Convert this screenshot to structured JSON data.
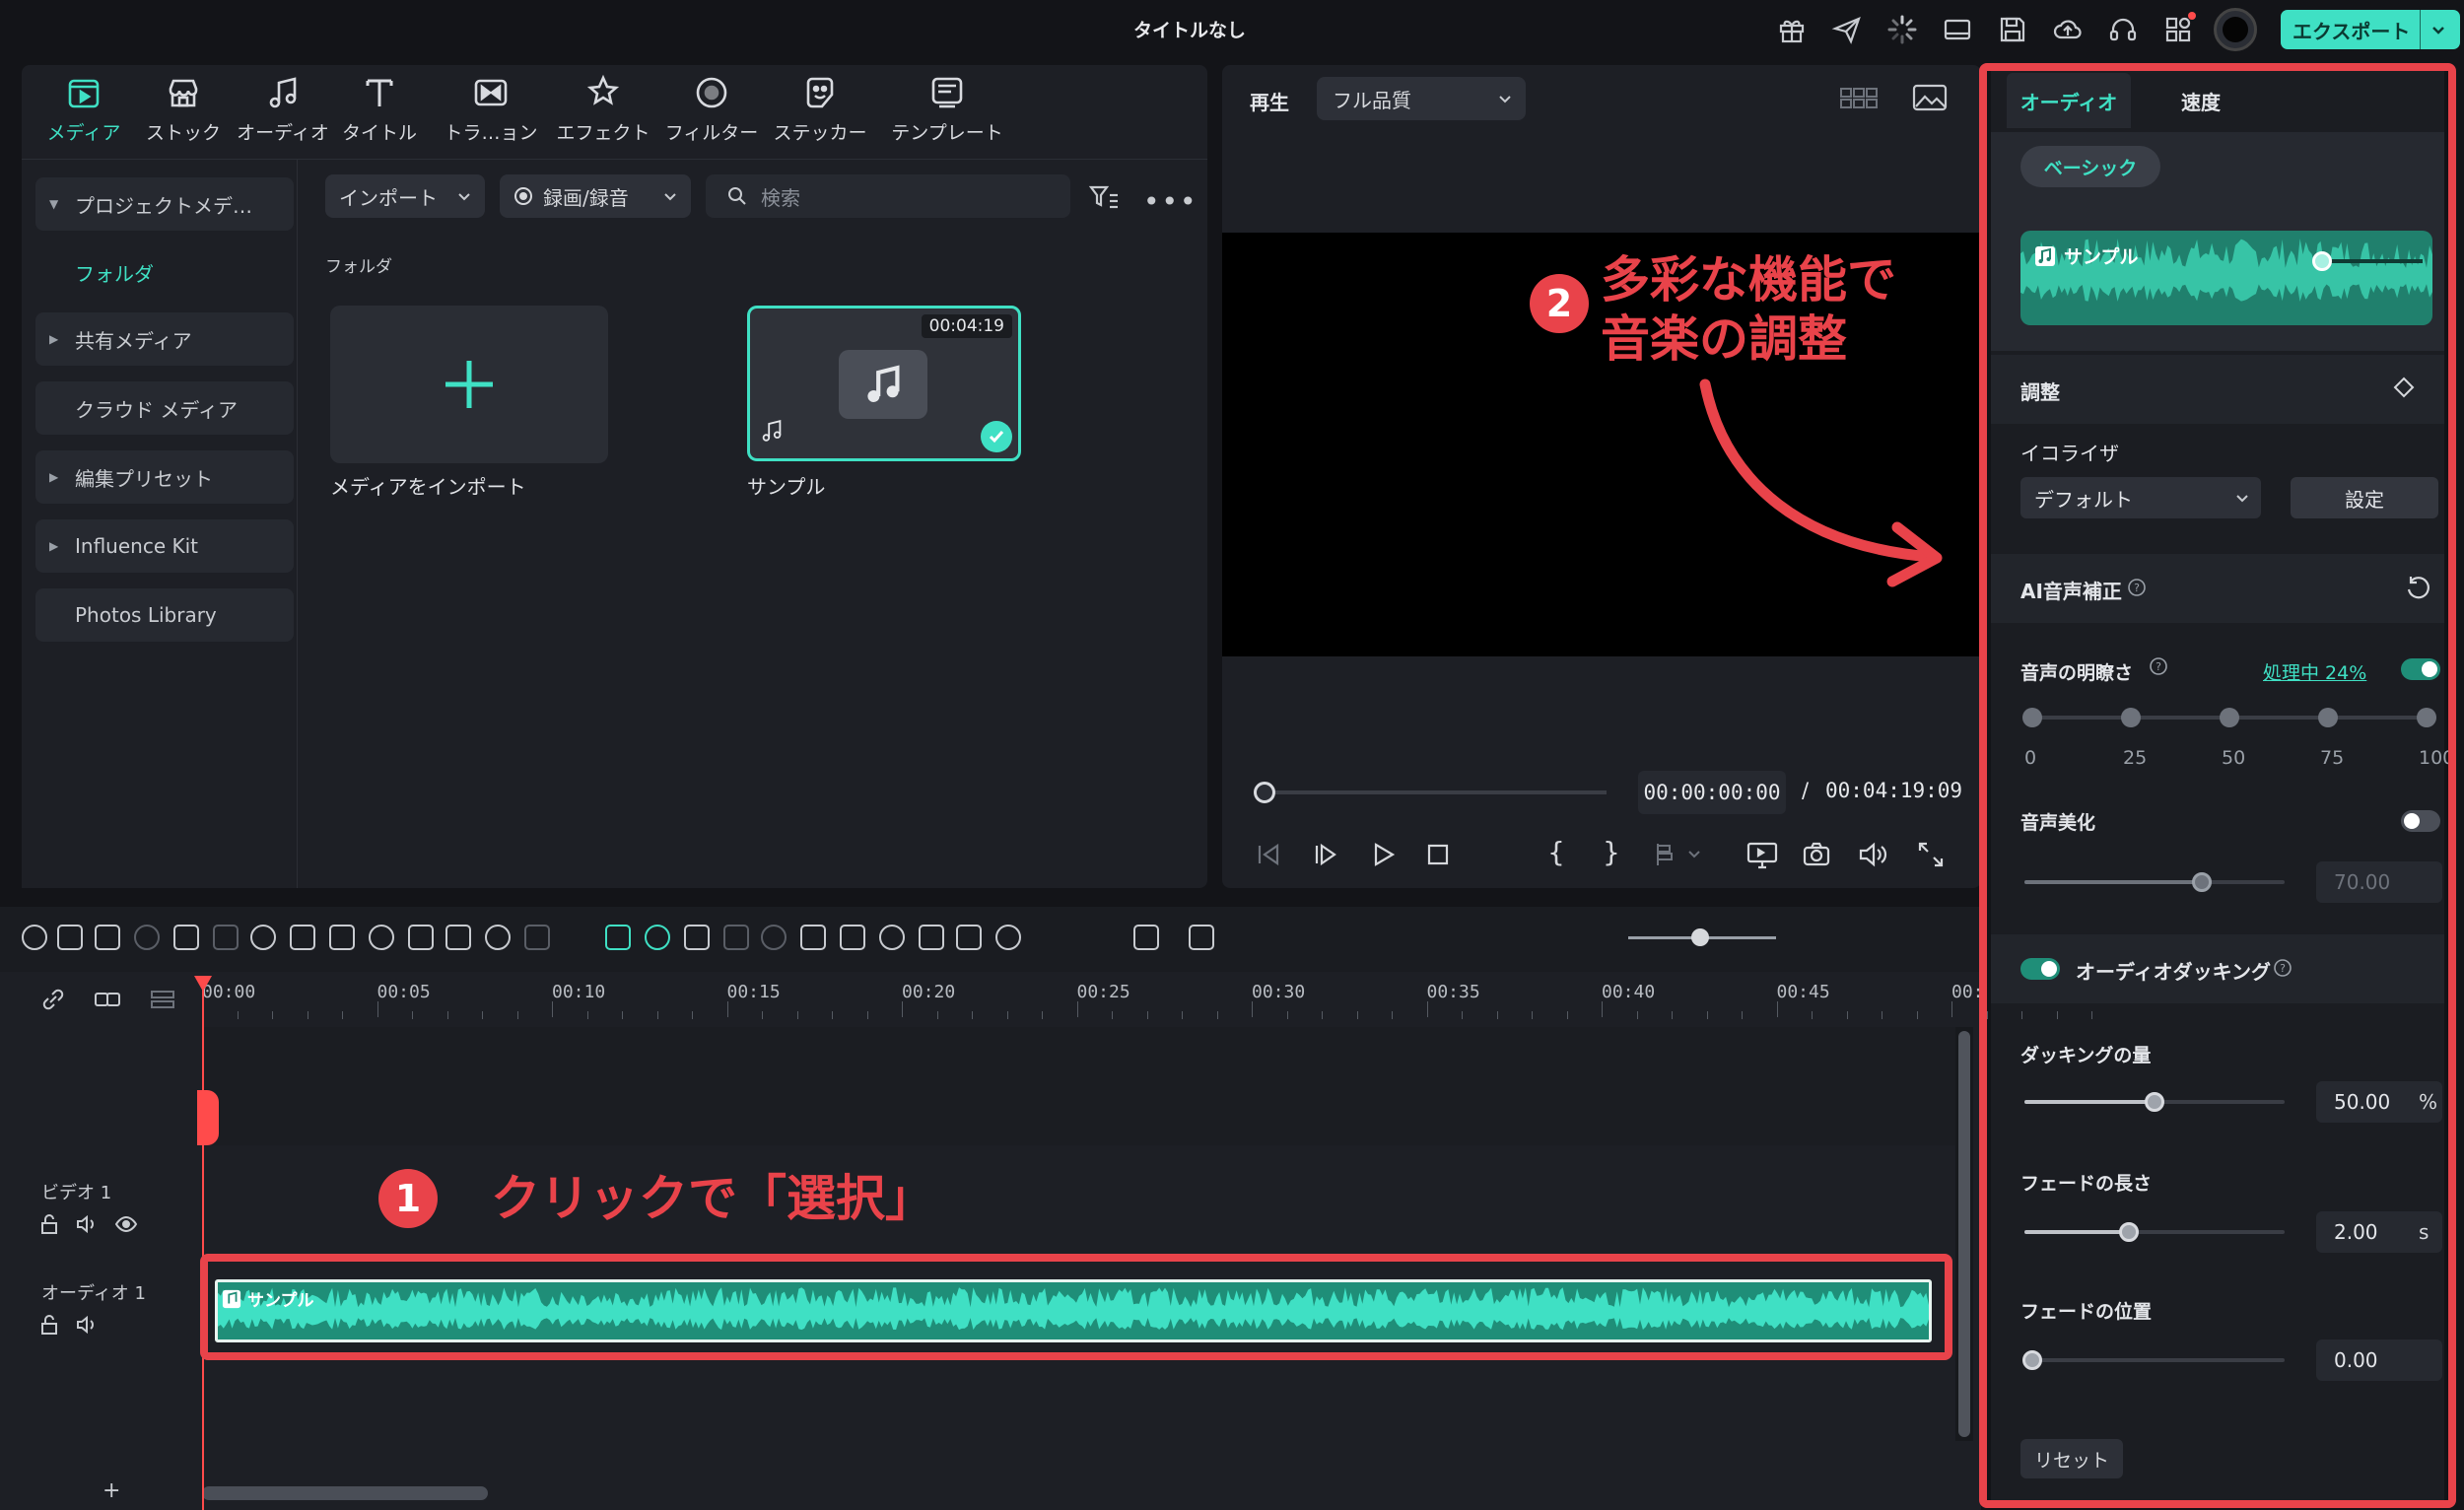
{
  "app": {
    "window_title": "タイトルなし",
    "export_label": "エクスポート",
    "accent_color": "#3fe0c4",
    "annotation_color": "#e9434a"
  },
  "top_icons": [
    "gift-icon",
    "send-icon",
    "loading-icon",
    "layout-icon",
    "save-icon",
    "cloud-upload-icon",
    "headset-icon",
    "apps-icon",
    "profile-avatar"
  ],
  "media_tabs": [
    {
      "label": "メディア",
      "icon": "media-icon",
      "active": true
    },
    {
      "label": "ストック",
      "icon": "stock-icon"
    },
    {
      "label": "オーディオ",
      "icon": "audio-note-icon"
    },
    {
      "label": "タイトル",
      "icon": "title-t-icon"
    },
    {
      "label": "トラ…ョン",
      "icon": "transition-icon"
    },
    {
      "label": "エフェクト",
      "icon": "effect-icon"
    },
    {
      "label": "フィルター",
      "icon": "filter-icon"
    },
    {
      "label": "ステッカー",
      "icon": "sticker-icon"
    },
    {
      "label": "テンプレート",
      "icon": "template-icon"
    }
  ],
  "sidebar": {
    "project_media": "プロジェクトメデ…",
    "folder": "フォルダ",
    "items": [
      {
        "label": "共有メディア",
        "arrow": true
      },
      {
        "label": "クラウド メディア",
        "arrow": false
      },
      {
        "label": "編集プリセット",
        "arrow": true
      },
      {
        "label": "Influence Kit",
        "arrow": true
      },
      {
        "label": "Photos Library",
        "arrow": false
      }
    ]
  },
  "media_toolbar": {
    "import_label": "インポート",
    "record_label": "録画/録音",
    "search_placeholder": "検索"
  },
  "media_area": {
    "section_label": "フォルダ",
    "import_tile_label": "メディアをインポート",
    "sample_tile_label": "サンプル",
    "sample_duration": "00:04:19"
  },
  "preview": {
    "play_label": "再生",
    "quality": "フル品質",
    "current_time": "00:00:00:00",
    "separator": "/",
    "total_time": "00:04:19:09"
  },
  "inspector": {
    "tabs": [
      "オーディオ",
      "速度"
    ],
    "basic_chip": "ベーシック",
    "clip_name": "サンプル",
    "adjust_title": "調整",
    "equalizer_label": "イコライザ",
    "equalizer_value": "デフォルト",
    "settings_button": "設定",
    "ai_voice_title": "AI音声補正",
    "clarity_label": "音声の明瞭さ",
    "processing_label": "処理中 24%",
    "clarity_ticks": [
      "0",
      "25",
      "50",
      "75",
      "100"
    ],
    "beautify_label": "音声美化",
    "beautify_value": "70.00",
    "ducking_label": "オーディオダッキング",
    "ducking_amount_label": "ダッキングの量",
    "ducking_amount_value": "50.00",
    "ducking_amount_unit": "%",
    "ducking_amount_level": 0.5,
    "fade_length_label": "フェードの長さ",
    "fade_length_value": "2.00",
    "fade_length_unit": "s",
    "fade_position_label": "フェードの位置",
    "fade_position_value": "0.00",
    "reset_button": "リセット"
  },
  "timeline": {
    "ruler_ticks": [
      "00:00",
      "00:05",
      "00:10",
      "00:15",
      "00:20",
      "00:25",
      "00:30",
      "00:35",
      "00:40",
      "00:45",
      "00:"
    ],
    "video_track_label": "ビデオ 1",
    "audio_track_label": "オーディオ 1",
    "clip_label": "サンプル",
    "add_track": "+"
  },
  "annotations": {
    "step1_number": "1",
    "step1_text": "クリックで「選択」",
    "step2_number": "2",
    "step2_line1": "多彩な機能で",
    "step2_line2": "音楽の調整"
  }
}
